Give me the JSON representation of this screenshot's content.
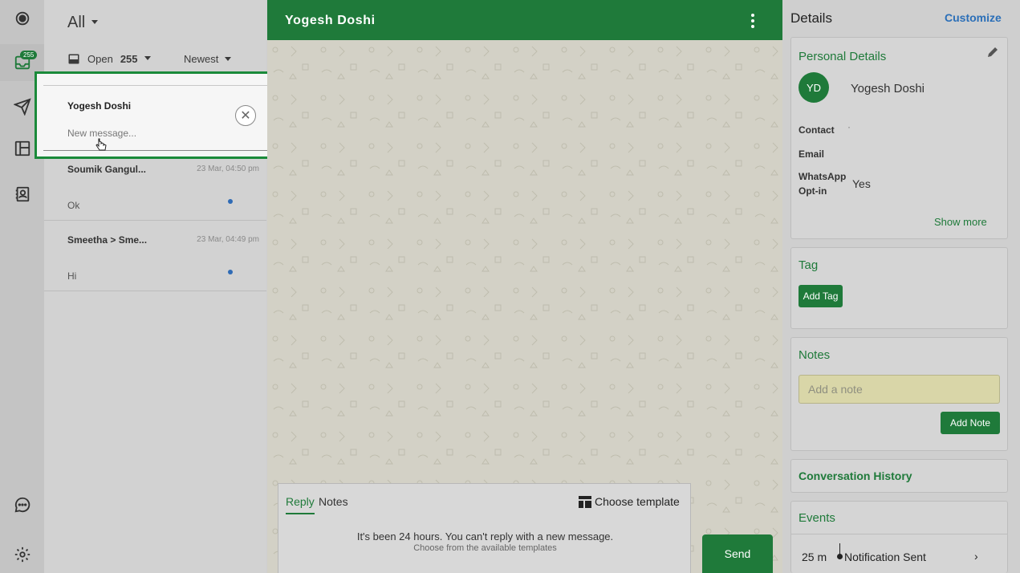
{
  "rail": {
    "badge": "255",
    "items": [
      "logo-icon",
      "inbox-icon",
      "send-icon",
      "layout-icon",
      "contacts-icon",
      "chat-bubble-icon",
      "gear-icon"
    ]
  },
  "list": {
    "filter": "All",
    "status_label": "Open",
    "status_count": "255",
    "sort_label": "Newest",
    "new_card": {
      "name": "Yogesh Doshi",
      "placeholder": "New message..."
    },
    "conversations": [
      {
        "name": "Soumik Gangul...",
        "time": "23 Mar, 04:50 pm",
        "message": "Ok"
      },
      {
        "name": "Smeetha > Sme...",
        "time": "23 Mar, 04:49 pm",
        "message": "Hi"
      }
    ]
  },
  "chat": {
    "title": "Yogesh Doshi",
    "reply_tab": "Reply",
    "notes_tab": "Notes",
    "template_label": "Choose template",
    "expired_message": "It's been 24 hours. You can't reply with a new message.",
    "expired_sub": "Choose from the available templates",
    "send_label": "Send"
  },
  "details": {
    "title": "Details",
    "customize": "Customize",
    "personal": {
      "title": "Personal Details",
      "initials": "YD",
      "name": "Yogesh Doshi",
      "contact_label": "Contact",
      "contact_value": "·",
      "email_label": "Email",
      "optin_label_1": "WhatsApp",
      "optin_label_2": "Opt-in",
      "optin_value": "Yes",
      "show_more": "Show more"
    },
    "tag": {
      "title": "Tag",
      "button": "Add Tag"
    },
    "notes": {
      "title": "Notes",
      "placeholder": "Add a note",
      "button": "Add Note"
    },
    "history": {
      "title": "Conversation History"
    },
    "events": {
      "title": "Events",
      "time": "25 m",
      "text": "Notification Sent"
    }
  },
  "colors": {
    "brand_green": "#1f7a3a",
    "link_blue": "#2b6fb8",
    "highlight_border": "#1a8a3a"
  }
}
